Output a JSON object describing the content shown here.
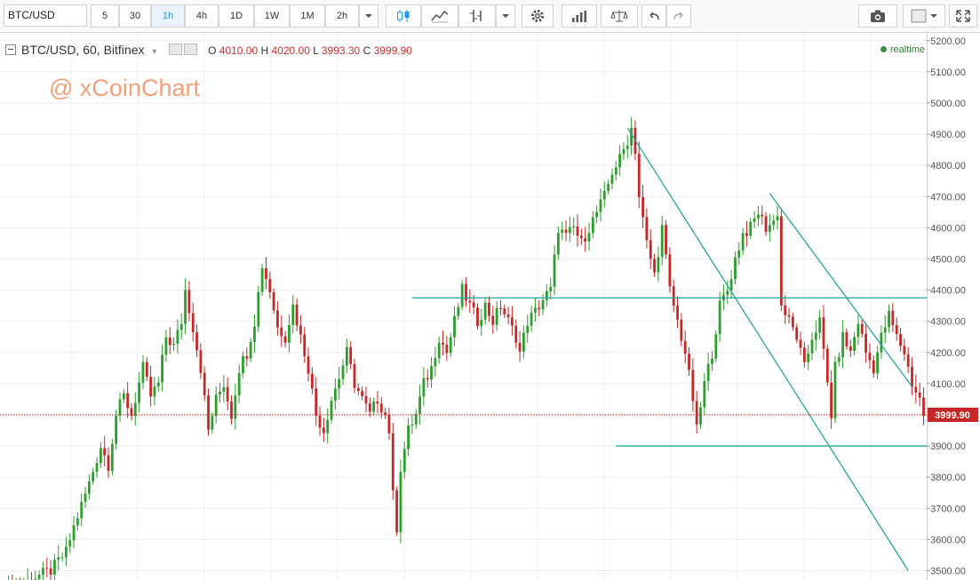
{
  "toolbar": {
    "symbol": "BTC/USD",
    "intervals": [
      "5",
      "30",
      "1h",
      "4h",
      "1D",
      "1W",
      "1M",
      "2h"
    ],
    "active_interval": "1h",
    "icons": [
      "candles-icon",
      "indicators-icon",
      "draw-icon",
      "settings-icon",
      "compare-icon",
      "templates-icon",
      "undo-icon",
      "redo-icon",
      "camera-icon",
      "color-icon",
      "fullscreen-icon"
    ]
  },
  "legend": {
    "title": "BTC/USD, 60, Bitfinex",
    "open_label": "O",
    "open": "4010.00",
    "high_label": "H",
    "high": "4020.00",
    "low_label": "L",
    "low": "3993.30",
    "close_label": "C",
    "close": "3999.90"
  },
  "status": {
    "realtime": "realtime"
  },
  "watermark": "@ xCoinChart",
  "price_axis": {
    "labels": [
      "5200.00",
      "5100.00",
      "5000.00",
      "4900.00",
      "4800.00",
      "4700.00",
      "4600.00",
      "4500.00",
      "4400.00",
      "4300.00",
      "4200.00",
      "4100.00",
      "4000.00",
      "3900.00",
      "3800.00",
      "3700.00",
      "3600.00",
      "3500.00"
    ],
    "current_price": "3999.90"
  },
  "colors": {
    "up": "#2e9e2e",
    "down": "#c62828",
    "trendline": "#26a69a",
    "price_line": "#c62828",
    "active": "#2196f3"
  },
  "chart_data": {
    "type": "candlestick",
    "ylim": [
      3470,
      5225
    ],
    "grid": true,
    "current_price": 3999.9,
    "path": [
      [
        0,
        3430
      ],
      [
        4,
        3450
      ],
      [
        8,
        3480
      ],
      [
        12,
        3500
      ],
      [
        16,
        3560
      ],
      [
        18,
        3640
      ],
      [
        22,
        3780
      ],
      [
        25,
        3900
      ],
      [
        27,
        3840
      ],
      [
        29,
        4000
      ],
      [
        31,
        4060
      ],
      [
        33,
        4000
      ],
      [
        36,
        4150
      ],
      [
        38,
        4060
      ],
      [
        40,
        4100
      ],
      [
        42,
        4250
      ],
      [
        44,
        4220
      ],
      [
        46,
        4300
      ],
      [
        47,
        4400
      ],
      [
        49,
        4280
      ],
      [
        51,
        4150
      ],
      [
        53,
        3950
      ],
      [
        55,
        4050
      ],
      [
        57,
        4100
      ],
      [
        59,
        4000
      ],
      [
        61,
        4150
      ],
      [
        63,
        4200
      ],
      [
        65,
        4300
      ],
      [
        67,
        4480
      ],
      [
        69,
        4400
      ],
      [
        71,
        4280
      ],
      [
        73,
        4250
      ],
      [
        75,
        4350
      ],
      [
        77,
        4250
      ],
      [
        79,
        4150
      ],
      [
        81,
        4000
      ],
      [
        83,
        3950
      ],
      [
        85,
        4050
      ],
      [
        87,
        4120
      ],
      [
        89,
        4200
      ],
      [
        91,
        4100
      ],
      [
        93,
        4050
      ],
      [
        95,
        4000
      ],
      [
        97,
        4050
      ],
      [
        99,
        4000
      ],
      [
        100,
        3950
      ],
      [
        101,
        3740
      ],
      [
        102,
        3640
      ],
      [
        103,
        3830
      ],
      [
        105,
        3950
      ],
      [
        107,
        4000
      ],
      [
        109,
        4100
      ],
      [
        111,
        4150
      ],
      [
        113,
        4250
      ],
      [
        115,
        4200
      ],
      [
        117,
        4300
      ],
      [
        119,
        4400
      ],
      [
        121,
        4350
      ],
      [
        123,
        4300
      ],
      [
        125,
        4350
      ],
      [
        127,
        4300
      ],
      [
        129,
        4350
      ],
      [
        131,
        4300
      ],
      [
        133,
        4250
      ],
      [
        134,
        4200
      ],
      [
        136,
        4300
      ],
      [
        138,
        4330
      ],
      [
        140,
        4370
      ],
      [
        142,
        4400
      ],
      [
        144,
        4600
      ],
      [
        146,
        4570
      ],
      [
        148,
        4600
      ],
      [
        150,
        4550
      ],
      [
        152,
        4600
      ],
      [
        154,
        4650
      ],
      [
        156,
        4700
      ],
      [
        158,
        4780
      ],
      [
        160,
        4820
      ],
      [
        162,
        4880
      ],
      [
        163,
        4920
      ],
      [
        164,
        4850
      ],
      [
        165,
        4700
      ],
      [
        167,
        4550
      ],
      [
        169,
        4450
      ],
      [
        171,
        4600
      ],
      [
        173,
        4400
      ],
      [
        175,
        4300
      ],
      [
        177,
        4200
      ],
      [
        179,
        4050
      ],
      [
        180,
        3950
      ],
      [
        182,
        4100
      ],
      [
        184,
        4200
      ],
      [
        186,
        4350
      ],
      [
        188,
        4400
      ],
      [
        190,
        4500
      ],
      [
        192,
        4580
      ],
      [
        194,
        4600
      ],
      [
        196,
        4650
      ],
      [
        198,
        4600
      ],
      [
        200,
        4620
      ],
      [
        201,
        4650
      ],
      [
        202,
        4350
      ],
      [
        204,
        4300
      ],
      [
        206,
        4250
      ],
      [
        208,
        4150
      ],
      [
        210,
        4250
      ],
      [
        212,
        4300
      ],
      [
        214,
        4100
      ],
      [
        215,
        4000
      ],
      [
        216,
        4150
      ],
      [
        218,
        4250
      ],
      [
        220,
        4200
      ],
      [
        222,
        4300
      ],
      [
        224,
        4200
      ],
      [
        226,
        4150
      ],
      [
        228,
        4250
      ],
      [
        230,
        4320
      ],
      [
        232,
        4250
      ],
      [
        234,
        4200
      ],
      [
        236,
        4100
      ],
      [
        238,
        4050
      ],
      [
        239,
        4000
      ],
      [
        240,
        3990
      ]
    ],
    "drawings": [
      {
        "kind": "trendline",
        "points": [
          [
            162,
            4920
          ],
          [
            235,
            3500
          ]
        ]
      },
      {
        "kind": "trendline",
        "points": [
          [
            199,
            4710
          ],
          [
            236,
            4090
          ]
        ]
      },
      {
        "kind": "hline",
        "x": [
          106,
          241
        ],
        "y": 4375
      },
      {
        "kind": "hline",
        "x": [
          159,
          241
        ],
        "y": 3900
      }
    ]
  }
}
